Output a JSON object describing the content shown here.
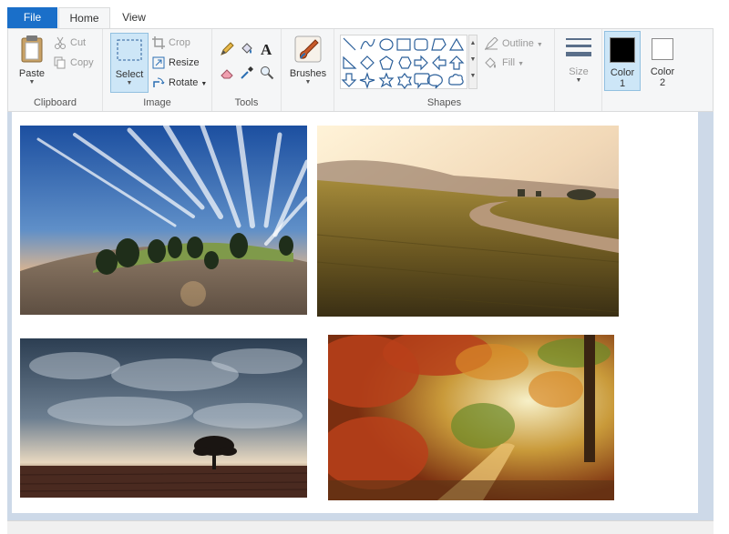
{
  "tabs": {
    "file": "File",
    "home": "Home",
    "view": "View"
  },
  "clipboard": {
    "paste": "Paste",
    "cut": "Cut",
    "copy": "Copy",
    "label": "Clipboard"
  },
  "image": {
    "select": "Select",
    "crop": "Crop",
    "resize": "Resize",
    "rotate": "Rotate",
    "label": "Image"
  },
  "tools": {
    "label": "Tools"
  },
  "brushes": {
    "label": "Brushes"
  },
  "shapes": {
    "outline": "Outline",
    "fill": "Fill",
    "label": "Shapes"
  },
  "size": {
    "label": "Size"
  },
  "colors": {
    "color1_line1": "Color",
    "color1_line2": "1",
    "color2_line1": "Color",
    "color2_line2": "2",
    "color1_value": "#000000",
    "color2_value": "#ffffff"
  },
  "photos": [
    {
      "subject": "sky-with-streaking-clouds-over-hill"
    },
    {
      "subject": "sunlit-field-with-path"
    },
    {
      "subject": "stormy-sky-with-lone-tree"
    },
    {
      "subject": "autumn-forest-path"
    }
  ]
}
